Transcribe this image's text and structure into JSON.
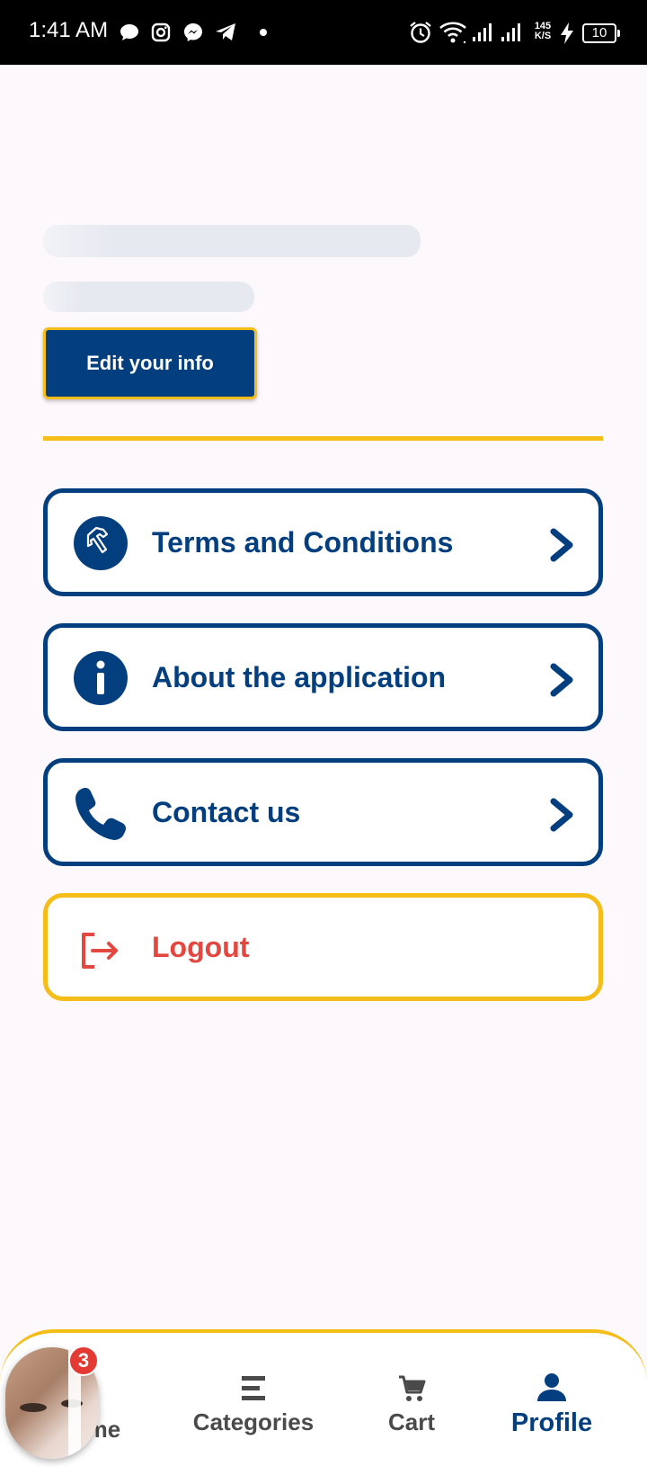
{
  "status_bar": {
    "time": "1:41 AM",
    "net_speed_value": "145",
    "net_speed_unit": "K/S",
    "battery": "10",
    "left_icons": [
      "chat-bubble-icon",
      "instagram-icon",
      "messenger-icon",
      "telegram-icon",
      "dot-icon"
    ],
    "right_icons": [
      "alarm-icon",
      "wifi-icon",
      "signal-icon",
      "signal-icon",
      "charging-icon"
    ]
  },
  "profile": {
    "edit_button_label": "Edit your info"
  },
  "menu": {
    "items": [
      {
        "label": "Terms and Conditions",
        "icon": "hammer-icon"
      },
      {
        "label": "About the application",
        "icon": "info-icon"
      },
      {
        "label": "Contact us",
        "icon": "phone-icon"
      }
    ],
    "logout_label": "Logout"
  },
  "bottom_nav": {
    "home_label": "Home",
    "categories_label": "Categories",
    "cart_label": "Cart",
    "profile_label": "Profile",
    "active": "Profile"
  },
  "chat_head": {
    "badge": "3"
  },
  "colors": {
    "primary": "#033f7e",
    "accent": "#f4bd18",
    "danger": "#e3473f",
    "background": "#fdf8fc"
  }
}
